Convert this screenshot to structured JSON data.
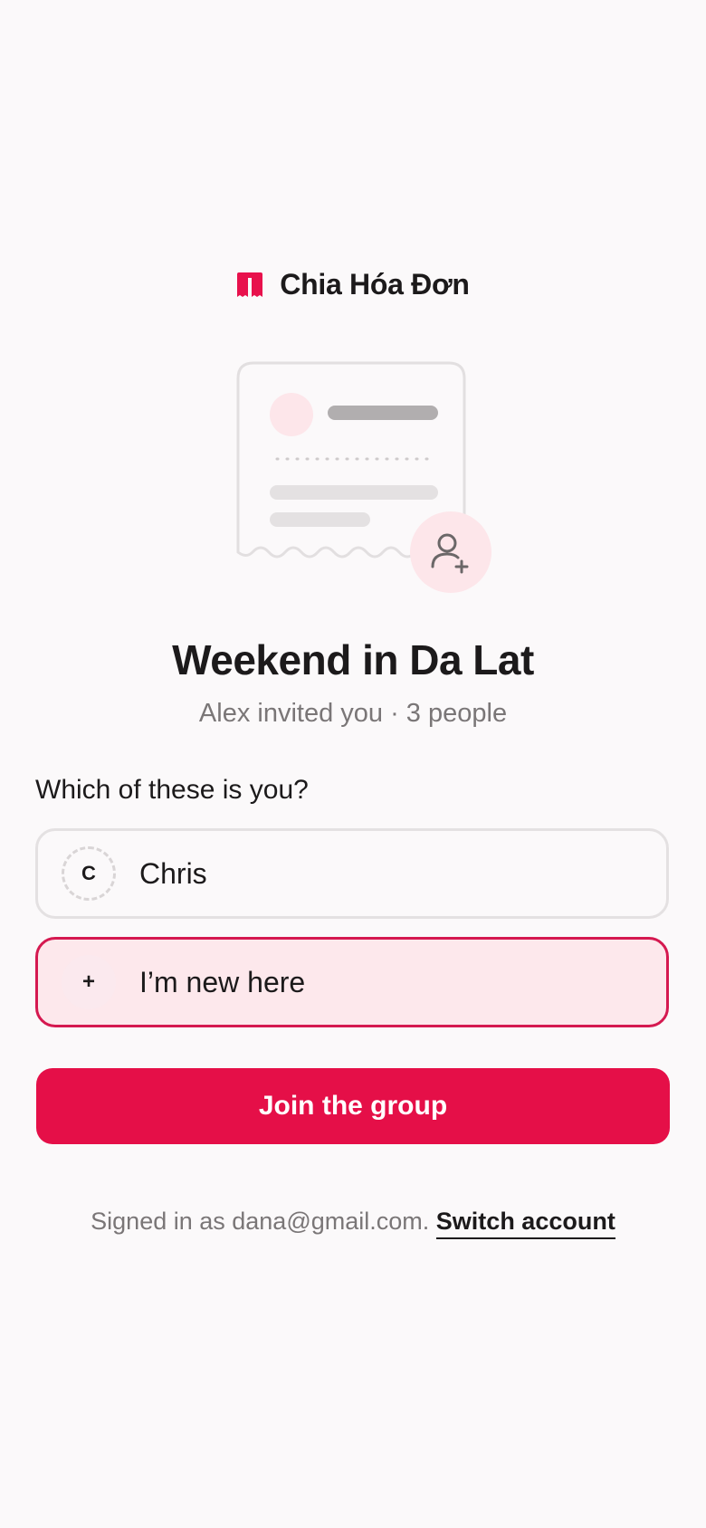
{
  "app": {
    "brand_name": "Chia Hóa Đơn",
    "brand_icon": "receipt-logo-icon",
    "accent_color": "#e50f48"
  },
  "invite": {
    "illustration_icon": "receipt-add-person-illustration",
    "group_name": "Weekend in Da Lat",
    "subtitle": "Alex invited you · 3 people"
  },
  "member_picker": {
    "question": "Which of these is you?",
    "options": [
      {
        "avatar_text": "C",
        "name": "Chris",
        "selected": false
      },
      {
        "avatar_text": "+",
        "name": "I’m new here",
        "selected": true
      }
    ]
  },
  "actions": {
    "join_label": "Join the group"
  },
  "account": {
    "signed_in_text": "Signed in as dana@gmail.com.",
    "switch_label": "Switch account"
  }
}
